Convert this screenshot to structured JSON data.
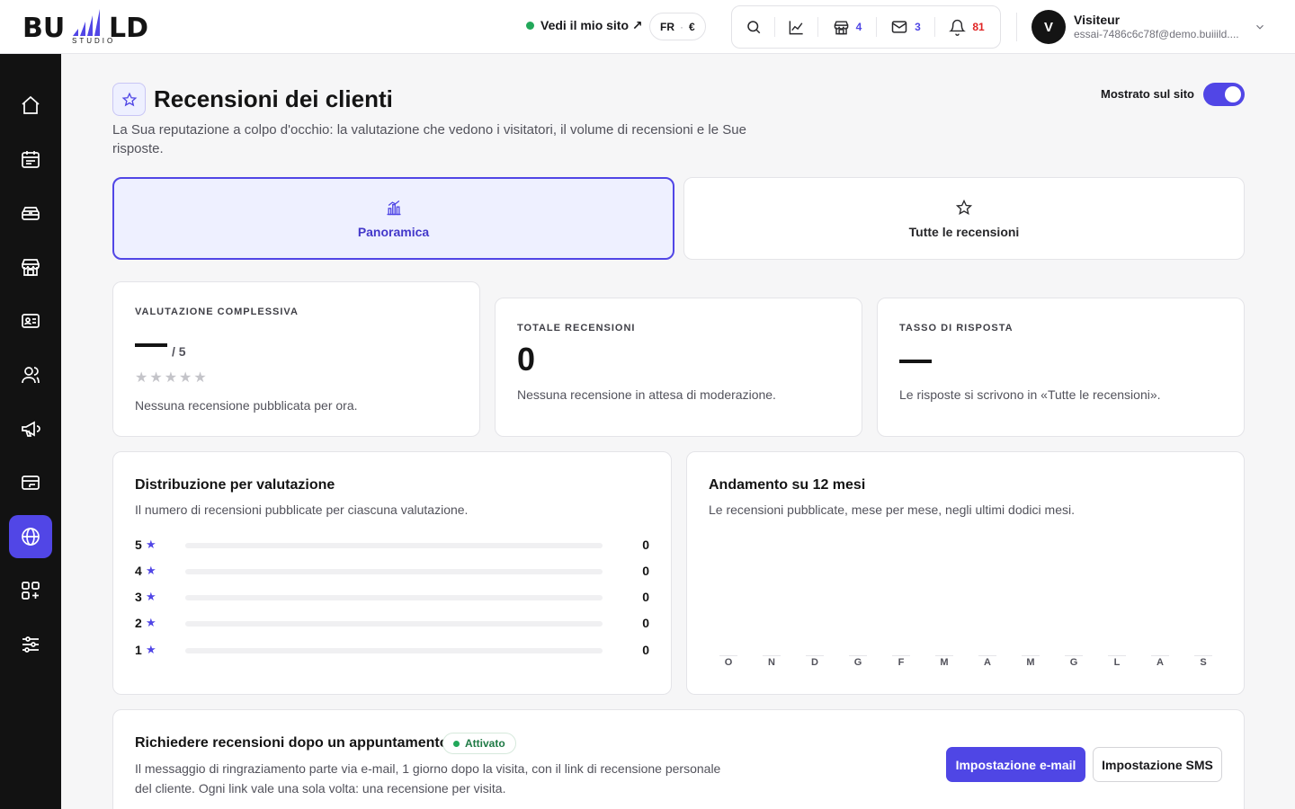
{
  "brand": {
    "logo_text": "BU LD",
    "logo_sub": "STUDIO"
  },
  "topbar": {
    "site_link": "Vedi il mio sito ↗",
    "lang": "FR",
    "currency": "€",
    "tools": [
      {
        "icon": "search-icon",
        "count": ""
      },
      {
        "icon": "chart-line-icon",
        "count": ""
      },
      {
        "icon": "store-icon",
        "count": "4"
      },
      {
        "icon": "mail-icon",
        "count": "3"
      },
      {
        "icon": "bell-icon",
        "count": "81"
      }
    ],
    "user": {
      "initial": "V",
      "name": "Visiteur",
      "email": "essai-7486c6c78f@demo.buiiild...."
    }
  },
  "sidebar": {
    "items": [
      {
        "icon": "home-icon",
        "active": false
      },
      {
        "icon": "calendar-icon",
        "active": false
      },
      {
        "icon": "tray-stack-icon",
        "active": false
      },
      {
        "icon": "store-icon",
        "active": false
      },
      {
        "icon": "contact-card-icon",
        "active": false
      },
      {
        "icon": "users-icon",
        "active": false
      },
      {
        "icon": "megaphone-icon",
        "active": false
      },
      {
        "icon": "credit-card-icon",
        "active": false
      },
      {
        "icon": "globe-icon",
        "active": true
      },
      {
        "icon": "apps-add-icon",
        "active": false
      },
      {
        "icon": "sliders-icon",
        "active": false
      }
    ]
  },
  "header": {
    "title": "Recensioni dei clienti",
    "description": "La Sua reputazione a colpo d'occhio: la valutazione che vedono i visitatori, il volume di recensioni e le Sue risposte.",
    "toggle_label": "Mostrato sul sito",
    "toggle_on": true
  },
  "tabs": [
    {
      "label": "Panoramica",
      "icon": "bar-chart-icon",
      "active": true
    },
    {
      "label": "Tutte le recensioni",
      "icon": "star-outline-icon",
      "active": false
    }
  ],
  "stats": {
    "overall": {
      "label": "VALUTAZIONE COMPLESSIVA",
      "value": "—",
      "out_of": "/ 5",
      "stars": "★★★★★",
      "sub": "Nessuna recensione pubblicata per ora."
    },
    "total": {
      "label": "TOTALE RECENSIONI",
      "value": "0",
      "sub": "Nessuna recensione in attesa di moderazione."
    },
    "rate": {
      "label": "TASSO DI RISPOSTA",
      "value": "—",
      "sub": "Le risposte si scrivono in «Tutte le recensioni»."
    }
  },
  "distribution": {
    "title": "Distribuzione per valutazione",
    "description": "Il numero di recensioni pubblicate per ciascuna valutazione.",
    "rows": [
      {
        "rating": "5",
        "count": 0
      },
      {
        "rating": "4",
        "count": 0
      },
      {
        "rating": "3",
        "count": 0
      },
      {
        "rating": "2",
        "count": 0
      },
      {
        "rating": "1",
        "count": 0
      }
    ]
  },
  "trend": {
    "title": "Andamento su 12 mesi",
    "description": "Le recensioni pubblicate, mese per mese, negli ultimi dodici mesi.",
    "months": [
      "O",
      "N",
      "D",
      "G",
      "F",
      "M",
      "A",
      "M",
      "G",
      "L",
      "A",
      "S"
    ]
  },
  "request": {
    "title": "Richiedere recensioni dopo un appuntamento",
    "badge": "Attivato",
    "description": "Il messaggio di ringraziamento parte via e-mail, 1 giorno dopo la visita, con il link di recensione personale del cliente. Ogni link vale una sola volta: una recensione per visita.",
    "email_button": "Impostazione e-mail",
    "sms_button": "Impostazione SMS"
  },
  "colors": {
    "accent": "#5146e6",
    "sidebar_bg": "#121212",
    "success": "#22a85a",
    "danger": "#e02424"
  }
}
